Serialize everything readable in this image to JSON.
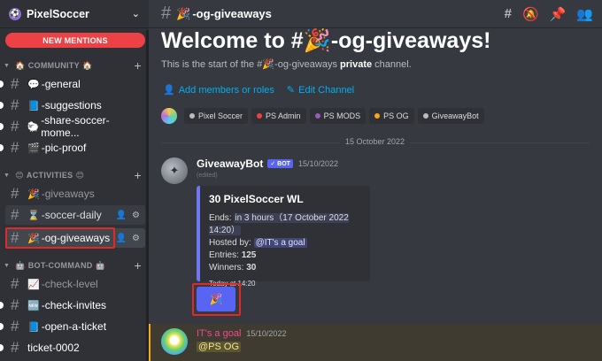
{
  "server": {
    "name": "PixelSoccer",
    "icon": "pixelsoccer-server-icon"
  },
  "sidebar": {
    "mentions_label": "NEW MENTIONS",
    "categories": [
      {
        "label": "COMMUNITY",
        "emoji": "🏠"
      },
      {
        "label": "ACTIVITIES",
        "emoji": "😊"
      },
      {
        "label": "BOT-COMMAND",
        "emoji": "🤖"
      }
    ],
    "channels": [
      {
        "name": "-general",
        "emoji": "💬"
      },
      {
        "name": "-suggestions",
        "emoji": "📘"
      },
      {
        "name": "-share-soccer-mome...",
        "emoji": "🐑"
      },
      {
        "name": "-pic-proof",
        "emoji": "🎬"
      },
      {
        "name": "-giveaways",
        "emoji": "🎉"
      },
      {
        "name": "-soccer-daily",
        "emoji": "⌛"
      },
      {
        "name": "-og-giveaways",
        "emoji": "🎉"
      },
      {
        "name": "-check-level",
        "emoji": "📈"
      },
      {
        "name": "-check-invites",
        "emoji": "🆕"
      },
      {
        "name": "-open-a-ticket",
        "emoji": "📘"
      },
      {
        "name": "ticket-0002",
        "emoji": ""
      }
    ]
  },
  "topbar": {
    "channel": "-og-giveaways",
    "emoji": "🎉"
  },
  "welcome": {
    "title_prefix": "Welcome to #",
    "title_emoji": "🎉",
    "title_suffix": "-og-giveaways!",
    "intro_start": "This is the start of the #",
    "intro_emoji": "🎉",
    "intro_channel": "-og-giveaways",
    "intro_private": "private",
    "intro_end": "channel.",
    "add_members": "Add members or roles",
    "edit_channel": "Edit Channel"
  },
  "roles": [
    {
      "name": "Pixel Soccer",
      "color": "#b9bbbe"
    },
    {
      "name": "PS Admin",
      "color": "#ed4245"
    },
    {
      "name": "PS MODS",
      "color": "#9b59b6"
    },
    {
      "name": "PS OG",
      "color": "#faa61a"
    },
    {
      "name": "GiveawayBot",
      "color": "#b9bbbe"
    }
  ],
  "date_divider": "15 October 2022",
  "bot_message": {
    "author": "GiveawayBot",
    "tag": "✓ BOT",
    "timestamp": "15/10/2022",
    "edited": "(edited)",
    "embed": {
      "title": "30 PixelSoccer WL",
      "ends_label": "Ends:",
      "ends_value": "in 3 hours（17 October 2022 14:20）",
      "hosted_label": "Hosted by:",
      "hosted_value": "@IT's a goal",
      "entries_label": "Entries:",
      "entries_value": "125",
      "winners_label": "Winners:",
      "winners_value": "30",
      "footer": "Today at 14:20"
    },
    "reaction": "🎉"
  },
  "user_message": {
    "author": "IT's a goal",
    "timestamp": "15/10/2022",
    "text": "@PS OG"
  }
}
